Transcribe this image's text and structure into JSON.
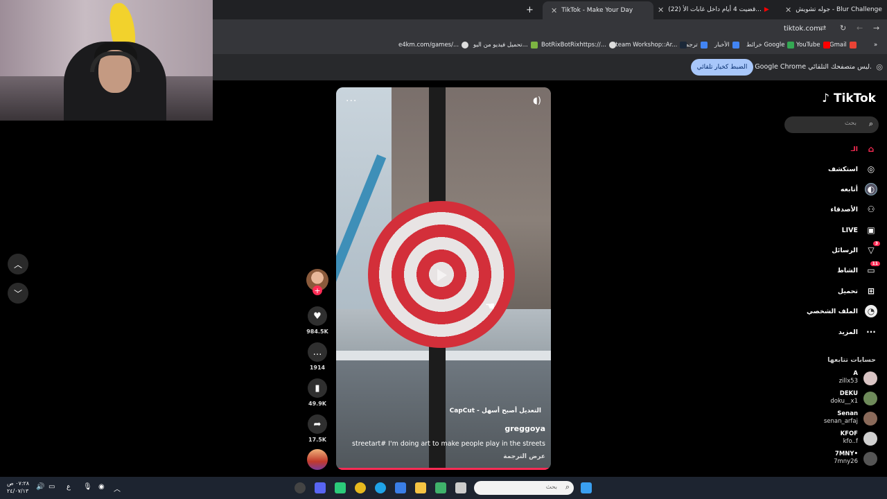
{
  "browser": {
    "tabs": [
      {
        "title": "جوله تشويش - Blur Challenge"
      },
      {
        "title": "(22) قضيت 4 أيام داخل غابات الأ..."
      },
      {
        "title": "TikTok - Make Your Day"
      }
    ],
    "url": "tiktok.com",
    "bookmarks": [
      "Gmail",
      "YouTube",
      "خرائط Google",
      "الأخبار",
      "ترجمة",
      "Steam Workshop::Ar...",
      "BotRixBotRixhttps://...",
      "تحميل فيديو من اليو...",
      "e4km.com/games/..."
    ],
    "infobar_text": "Google Chrome ليس متصفحك التلقائي.",
    "infobar_button": "الضبط كخيار تلقائي"
  },
  "video": {
    "capcut_label": "CapCut - التعديل أصبح أسهل",
    "username": "greggoya",
    "description": "streetart# I'm doing art to make people play in the streets",
    "translate_label": "عرض الترجمة",
    "likes": "984.5K",
    "comments": "1914",
    "saves": "49.9K",
    "shares": "17.5K"
  },
  "tiktok": {
    "logo": "TikTok",
    "search_placeholder": "بحث",
    "nav": [
      {
        "label": "الـ",
        "icon": "home-icon"
      },
      {
        "label": "استكشف",
        "icon": "compass-icon"
      },
      {
        "label": "أتابعه",
        "icon": "avatar-icon"
      },
      {
        "label": "الأصدقاء",
        "icon": "friends-icon"
      },
      {
        "label": "LIVE",
        "icon": "live-icon"
      },
      {
        "label": "الرسائل",
        "icon": "send-icon",
        "badge": "3"
      },
      {
        "label": "الشاط",
        "icon": "inbox-icon",
        "badge": "11"
      },
      {
        "label": "تحميل",
        "icon": "upload-icon"
      },
      {
        "label": "الملف الشخصي",
        "icon": "profile-icon"
      },
      {
        "label": "المزيد",
        "icon": "more-icon"
      }
    ],
    "following_title": "حسابات تتابعها",
    "accounts": [
      {
        "name": "A",
        "handle": "zillx53"
      },
      {
        "name": "DEKU",
        "handle": "doku__x1"
      },
      {
        "name": "Senan",
        "handle": "senan_arfaj"
      },
      {
        "name": "KFOF",
        "handle": "kfo..f"
      },
      {
        "name": "7MNY•",
        "handle": "7mny26"
      }
    ]
  },
  "taskbar": {
    "search_placeholder": "بحث",
    "time": "٠٧:٢٨ ص",
    "date": "٢٤/٠٧/١٣",
    "lang": "ع"
  }
}
